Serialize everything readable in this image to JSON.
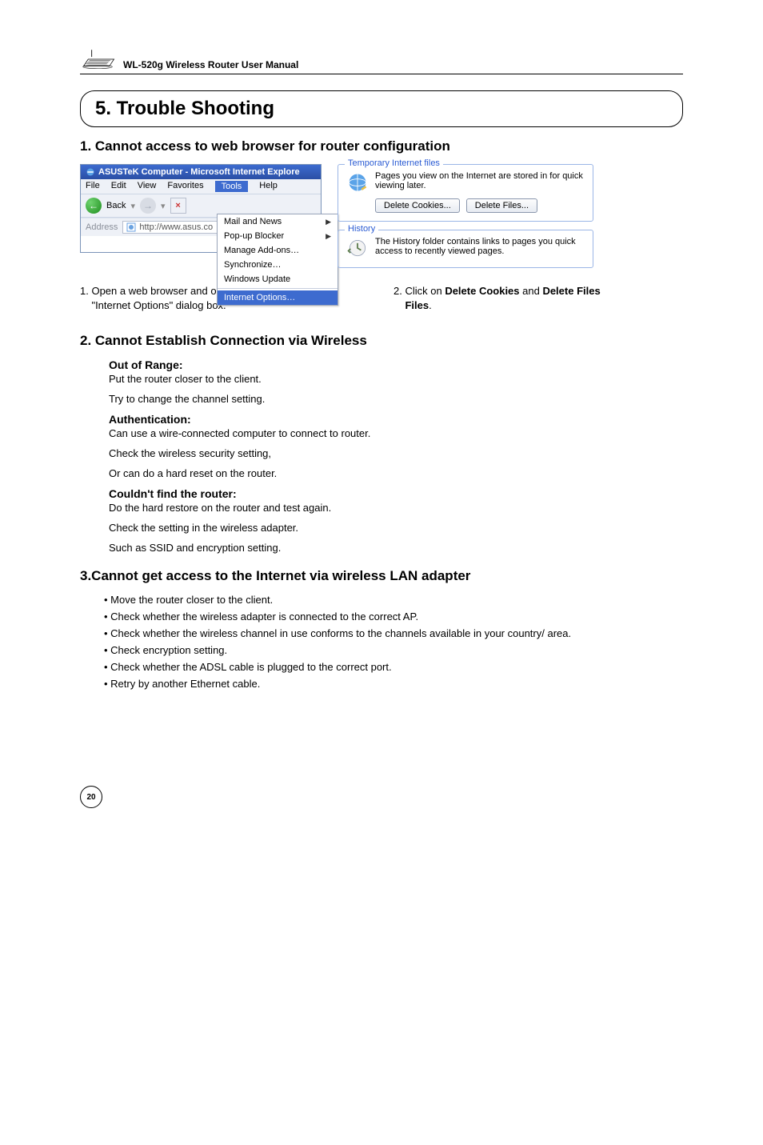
{
  "header": {
    "product_line": "WL-520g Wireless Router User Manual"
  },
  "chapter": {
    "title": "5. Trouble Shooting"
  },
  "section1": {
    "heading": "1. Cannot access to web browser for router configuration",
    "ie": {
      "title": "ASUSTeK Computer - Microsoft Internet Explore",
      "menu": {
        "file": "File",
        "edit": "Edit",
        "view": "View",
        "favorites": "Favorites",
        "tools": "Tools",
        "help": "Help"
      },
      "toolbar": {
        "back": "Back"
      },
      "address_label": "Address",
      "address_value": "http://www.asus.co",
      "drop": {
        "mail": "Mail and News",
        "popup": "Pop-up Blocker",
        "addons": "Manage Add-ons…",
        "sync": "Synchronize…",
        "update": "Windows Update",
        "iopt": "Internet Options…"
      }
    },
    "opts": {
      "tif_legend": "Temporary Internet files",
      "tif_text": "Pages you view on the Internet are stored in for quick viewing later.",
      "btn_cookies": "Delete Cookies...",
      "btn_files": "Delete Files...",
      "hist_legend": "History",
      "hist_text": "The History folder contains links to pages you quick access to recently viewed pages."
    },
    "caption1a": "1. Open a web browser and open",
    "caption1b": "\"Internet Options\" dialog box.",
    "caption2a": "2. Click on ",
    "caption2b": "Delete Cookies",
    "caption2c": " and ",
    "caption2d": "Delete Files",
    "caption2e": "."
  },
  "section2": {
    "heading": "2. Cannot Establish Connection via Wireless",
    "sub1": "Out of Range:",
    "p1": "Put the router closer to the client.",
    "p2": "Try to change the channel setting.",
    "sub2": "Authentication:",
    "p3": "Can use a wire-connected computer to connect to router.",
    "p4": "Check the wireless security setting,",
    "p5": "Or can do a hard reset on the router.",
    "sub3": "Couldn't find the router:",
    "p6": "Do the hard restore on the router and test again.",
    "p7": "Check the setting in the wireless adapter.",
    "p8": "Such as SSID and encryption setting."
  },
  "section3": {
    "heading": "3.Cannot get access to the Internet via wireless LAN adapter",
    "b1": "Move the router closer to the client.",
    "b2": "Check whether the wireless adapter is connected to the correct AP.",
    "b3": "Check whether the wireless channel in use conforms to the channels available in your country/ area.",
    "b4": "Check encryption setting.",
    "b5": "Check whether the ADSL cable is plugged to the correct port.",
    "b6": "Retry by another Ethernet cable."
  },
  "page_number": "20"
}
